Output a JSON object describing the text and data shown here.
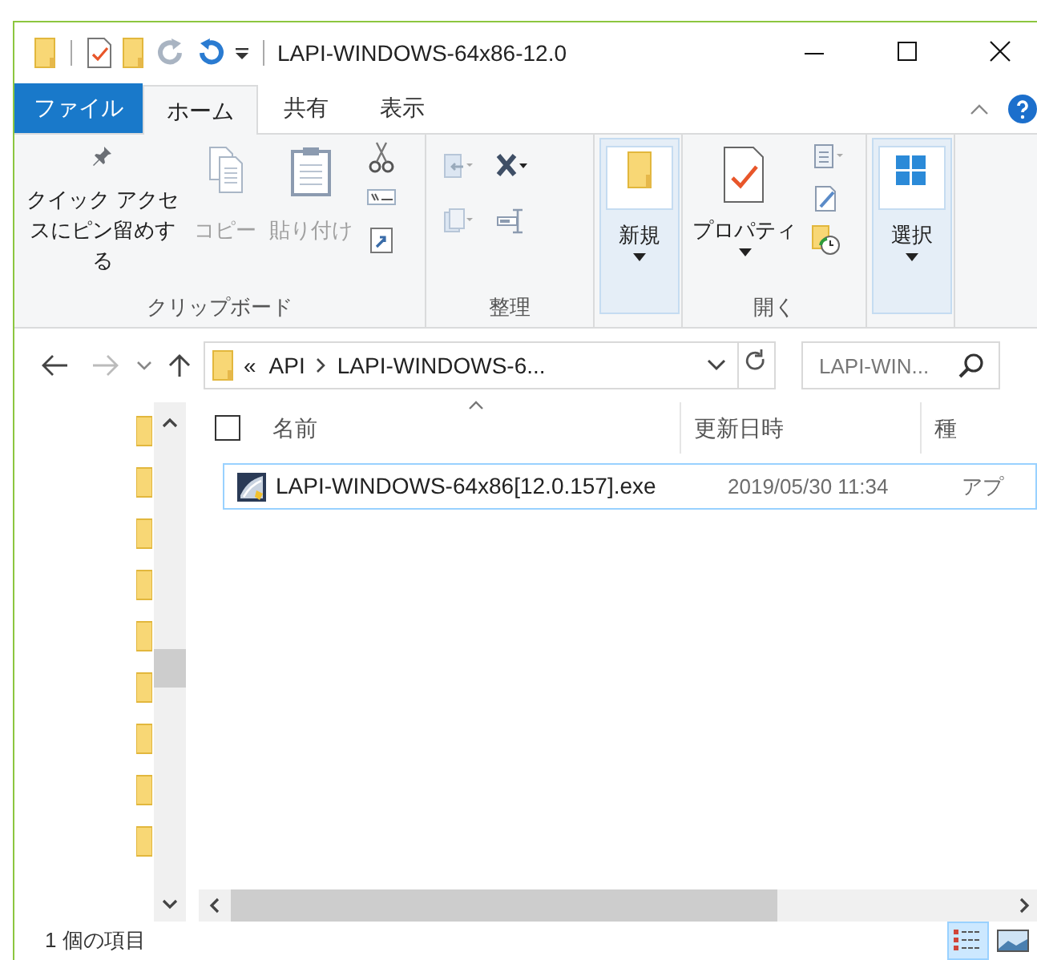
{
  "window": {
    "title": "LAPI-WINDOWS-64x86-12.0"
  },
  "tabs": [
    {
      "label": "ファイル",
      "kind": "file",
      "selected": false
    },
    {
      "label": "ホーム",
      "kind": "tab",
      "selected": true
    },
    {
      "label": "共有",
      "kind": "tab",
      "selected": false
    },
    {
      "label": "表示",
      "kind": "tab",
      "selected": false
    }
  ],
  "ribbon": {
    "groups": [
      {
        "label": "クリップボード",
        "buttons": [
          {
            "label": "クイック アクセスにピン留めする",
            "disabled": false,
            "highlighted": false,
            "dropdown": false
          },
          {
            "label": "コピー",
            "disabled": true,
            "highlighted": false,
            "dropdown": false
          },
          {
            "label": "貼り付け",
            "disabled": true,
            "highlighted": false,
            "dropdown": false
          }
        ]
      },
      {
        "label": "整理"
      },
      {
        "buttons": [
          {
            "label": "新規",
            "disabled": false,
            "highlighted": true,
            "dropdown": true
          }
        ]
      },
      {
        "label": "開く",
        "buttons": [
          {
            "label": "プロパティ",
            "disabled": false,
            "highlighted": false,
            "dropdown": true
          }
        ]
      },
      {
        "buttons": [
          {
            "label": "選択",
            "disabled": false,
            "highlighted": true,
            "dropdown": true
          }
        ]
      }
    ]
  },
  "address": {
    "segments": [
      "«",
      "API",
      "LAPI-WINDOWS-6..."
    ]
  },
  "search": {
    "placeholder": "LAPI-WIN..."
  },
  "select_all": {
    "checked": false
  },
  "columns": [
    {
      "label": "名前"
    },
    {
      "label": "更新日時"
    },
    {
      "label": "種"
    }
  ],
  "rows": [
    {
      "name": "LAPI-WINDOWS-64x86[12.0.157].exe",
      "date": "2019/05/30 11:34",
      "type": "アプ",
      "selected": true
    }
  ],
  "status_bar": {
    "count": "1 個の項目"
  },
  "views": [
    {
      "kind": "details",
      "selected": true
    },
    {
      "kind": "large-icons",
      "selected": false
    }
  ]
}
